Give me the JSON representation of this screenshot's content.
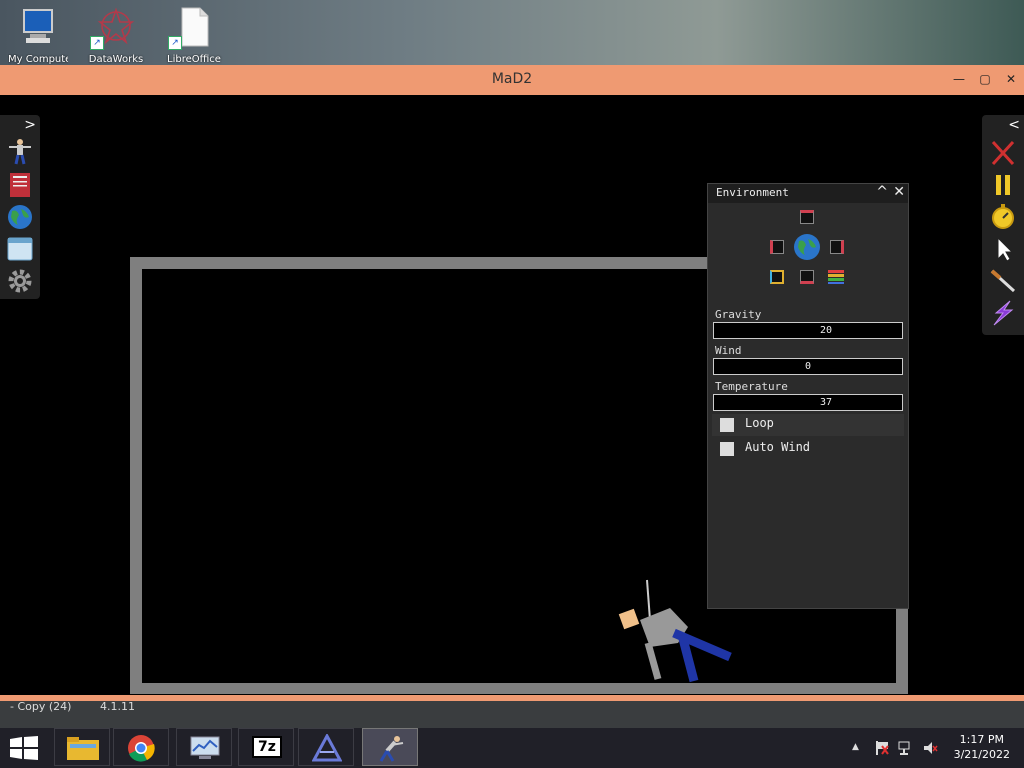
{
  "desktop": {
    "icons": [
      {
        "label": "My Computer",
        "name": "my-computer"
      },
      {
        "label": "DataWorks",
        "name": "data-app"
      },
      {
        "label": "LibreOffice",
        "name": "libreoffice"
      }
    ]
  },
  "window": {
    "title": "MaD2",
    "minimize_glyph": "—",
    "maximize_glyph": "▢",
    "close_glyph": "✕",
    "status_left": "- Copy (24)",
    "status_version": "4.1.11"
  },
  "toolbar_left": {
    "toggle_glyph": ">",
    "items": [
      "ragdoll-icon",
      "book-icon",
      "globe-icon",
      "window-icon",
      "gear-icon"
    ]
  },
  "toolbar_right": {
    "toggle_glyph": "<",
    "items": [
      "close-x-icon",
      "pause-icon",
      "stopwatch-icon",
      "cursor-icon",
      "knife-icon",
      "lightning-icon"
    ]
  },
  "environment": {
    "title": "Environment",
    "collapse_glyph": "^",
    "close_glyph": "✕",
    "gravity": {
      "label": "Gravity",
      "value": "20"
    },
    "wind": {
      "label": "Wind",
      "value": "0"
    },
    "temperature": {
      "label": "Temperature",
      "value": "37"
    },
    "loop": {
      "label": "Loop",
      "checked": false
    },
    "auto_wind": {
      "label": "Auto Wind",
      "checked": false
    }
  },
  "taskbar": {
    "time": "1:17 PM",
    "date": "3/21/2022",
    "tray_arrow": "▲",
    "apps": [
      "file-explorer",
      "chrome",
      "system-monitor",
      "7zip",
      "app-launcher",
      "mad2-game"
    ],
    "seven_zip_label": "7z"
  },
  "colors": {
    "accent": "#ef9a72",
    "arena_wall": "#7f7f7f"
  }
}
